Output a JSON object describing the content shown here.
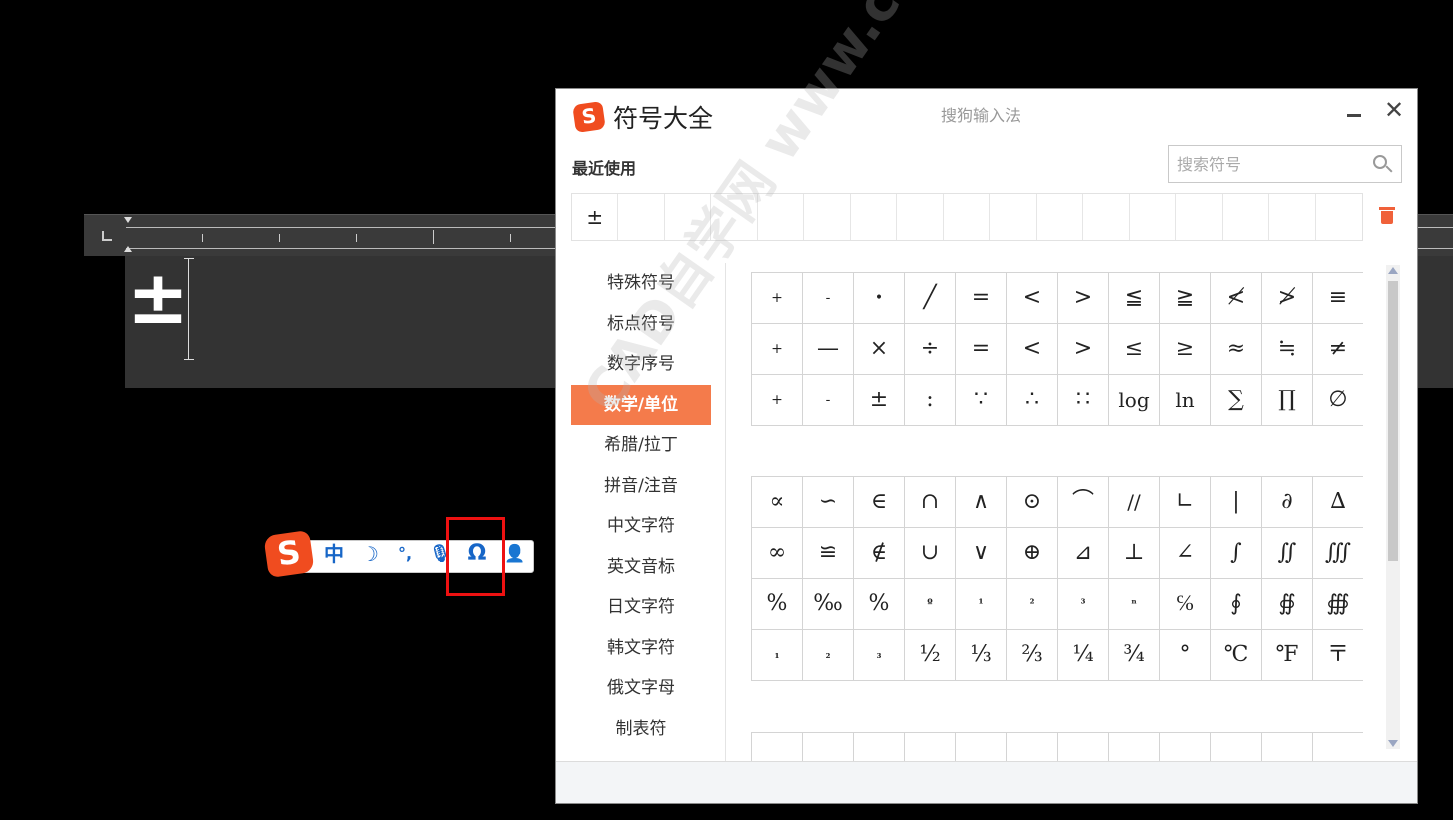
{
  "editor": {
    "inserted_char": "±"
  },
  "ime_toolbar": {
    "logo": "S",
    "mode_label": "中",
    "moon_glyph": "☽",
    "punct_glyph": "°,",
    "mic_glyph": "🎙",
    "omega_glyph": "Ω",
    "user_glyph": "👤",
    "highlight_color": "#ee1111",
    "icon_color": "#1766c7"
  },
  "dialog": {
    "logo": "S",
    "title": "符号大全",
    "subtitle": "搜狗输入法",
    "minimize_glyph": "—",
    "close_glyph": "✕",
    "recent_label": "最近使用",
    "search_placeholder": "搜索符号",
    "recent": [
      "±",
      "",
      "",
      "",
      "",
      "",
      "",
      "",
      "",
      "",
      "",
      "",
      "",
      "",
      "",
      "",
      ""
    ],
    "accent": "#f47b4b",
    "categories": [
      {
        "label": "特殊符号",
        "active": false
      },
      {
        "label": "标点符号",
        "active": false
      },
      {
        "label": "数字序号",
        "active": false
      },
      {
        "label": "数学/单位",
        "active": true
      },
      {
        "label": "希腊/拉丁",
        "active": false
      },
      {
        "label": "拼音/注音",
        "active": false
      },
      {
        "label": "中文字符",
        "active": false
      },
      {
        "label": "英文音标",
        "active": false
      },
      {
        "label": "日文字符",
        "active": false
      },
      {
        "label": "韩文字符",
        "active": false
      },
      {
        "label": "俄文字母",
        "active": false
      },
      {
        "label": "制表符",
        "active": false
      }
    ],
    "group_a": [
      "+",
      "-",
      "•",
      "╱",
      "=",
      "<",
      ">",
      "≦",
      "≧",
      "≮",
      "≯",
      "≡",
      "+",
      "—",
      "×",
      "÷",
      "=",
      "<",
      ">",
      "≤",
      "≥",
      "≈",
      "≒",
      "≠",
      "+",
      "-",
      "±",
      ":",
      "∵",
      "∴",
      "∷",
      "log",
      "ln",
      "∑",
      "∏",
      "∅"
    ],
    "group_b": [
      "∝",
      "∽",
      "∈",
      "∩",
      "∧",
      "⊙",
      "⌒",
      "//",
      "∟",
      "|",
      "∂",
      "∆",
      "∞",
      "≌",
      "∉",
      "∪",
      "∨",
      "⊕",
      "⊿",
      "⊥",
      "∠",
      "∫",
      "∬",
      "∭",
      "%",
      "‰",
      "%",
      "º",
      "¹",
      "²",
      "³",
      "ⁿ",
      "℅",
      "∮",
      "∯",
      "∰",
      "₁",
      "₂",
      "₃",
      "½",
      "⅓",
      "⅔",
      "¼",
      "¾",
      "°",
      "℃",
      "℉",
      "〒"
    ],
    "group_c": [
      "",
      "",
      "",
      "",
      "",
      "",
      "",
      "",
      "",
      "",
      "",
      ""
    ]
  },
  "watermark": "CAD自学网 www.cadzxw.com"
}
